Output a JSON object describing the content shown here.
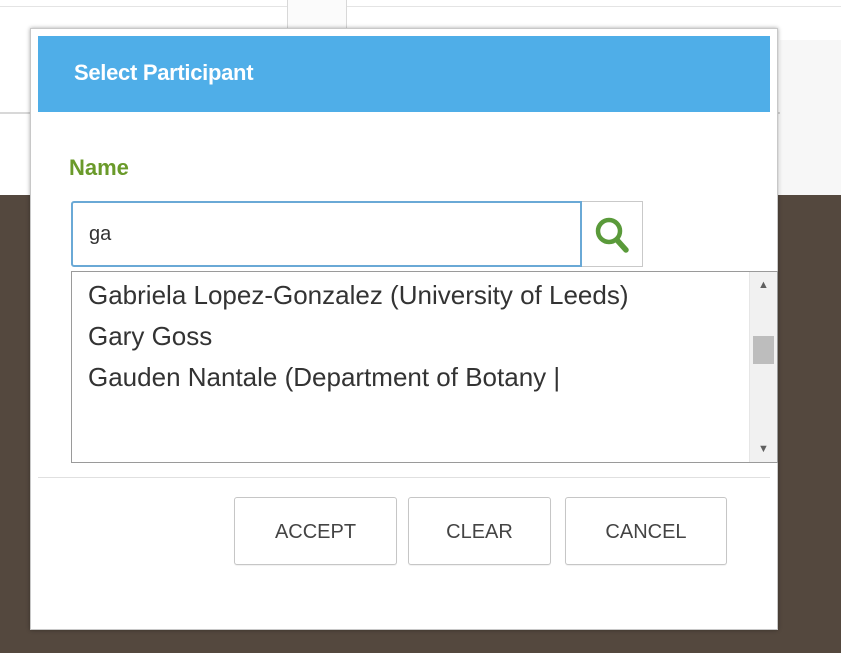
{
  "modal": {
    "title": "Select Participant",
    "name_label": "Name",
    "search": {
      "value": "ga",
      "placeholder": ""
    },
    "search_icon": "search-icon",
    "results": [
      "Gabriela Lopez-Gonzalez (University of Leeds)",
      "Gary Goss",
      "Gauden Nantale (Department of Botany |"
    ],
    "buttons": {
      "accept": "ACCEPT",
      "clear": "CLEAR",
      "cancel": "CANCEL"
    }
  },
  "colors": {
    "header_bg": "#4faee8",
    "name_label": "#6a9a2a",
    "search_icon": "#5a9a3a",
    "backdrop": "#54483e"
  },
  "scroll": {
    "position": 0.25
  }
}
